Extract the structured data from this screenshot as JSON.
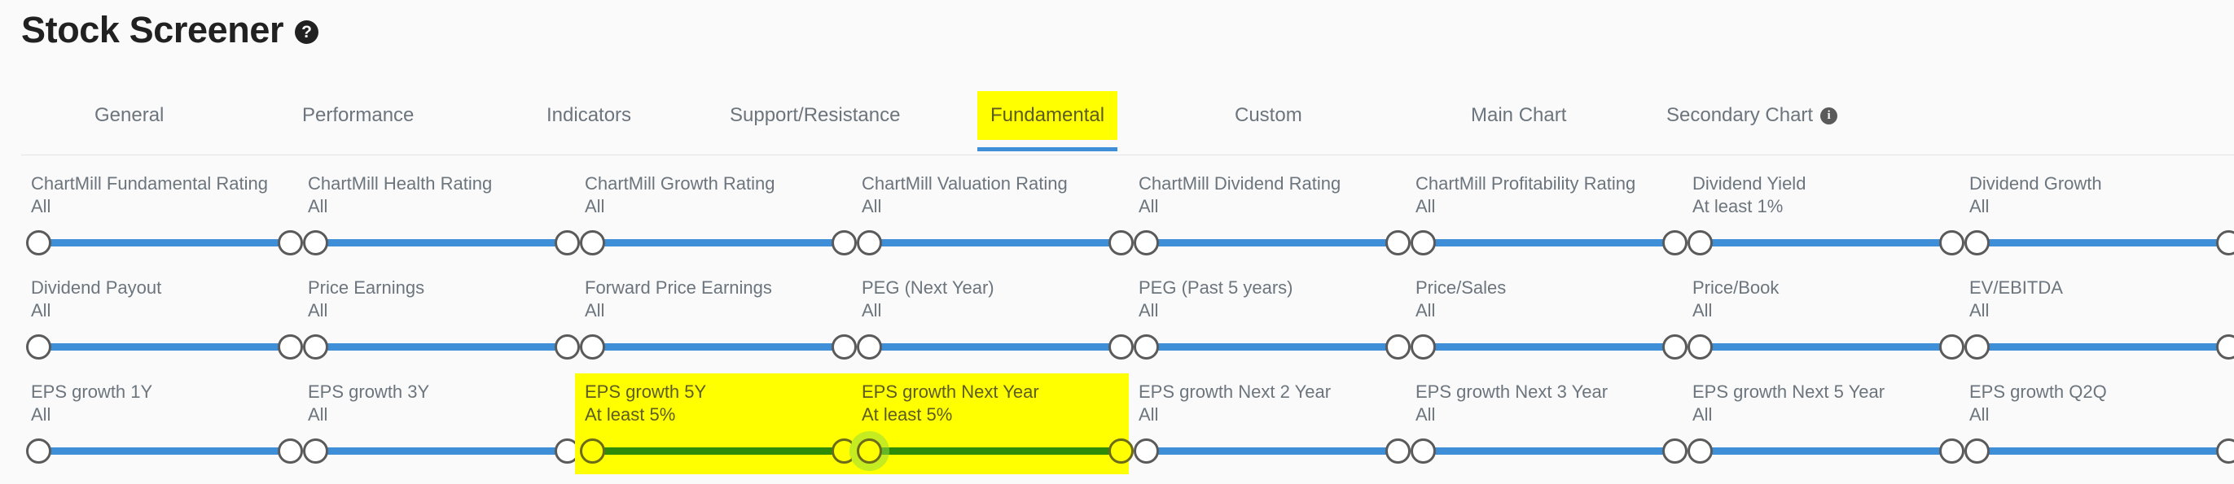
{
  "header": {
    "title": "Stock Screener",
    "help_icon_glyph": "?",
    "help_icon_name": "help-circle-icon"
  },
  "tabs": [
    {
      "label": "General",
      "active": false,
      "highlighted": false,
      "info": false
    },
    {
      "label": "Performance",
      "active": false,
      "highlighted": false,
      "info": false
    },
    {
      "label": "Indicators",
      "active": false,
      "highlighted": false,
      "info": false
    },
    {
      "label": "Support/Resistance",
      "active": false,
      "highlighted": false,
      "info": false
    },
    {
      "label": "Fundamental",
      "active": true,
      "highlighted": true,
      "info": false
    },
    {
      "label": "Custom",
      "active": false,
      "highlighted": false,
      "info": false
    },
    {
      "label": "Main Chart",
      "active": false,
      "highlighted": false,
      "info": false
    },
    {
      "label": "Secondary Chart",
      "active": false,
      "highlighted": false,
      "info": true,
      "info_glyph": "i"
    }
  ],
  "colors": {
    "page_background": "#fafafa",
    "accent_blue": "#3f8fd8",
    "highlight_yellow": "#ffff00",
    "active_green": "#2e8b07",
    "label_gray": "#6c757d",
    "title_black": "#212121"
  },
  "filters": [
    [
      {
        "label": "ChartMill Fundamental Rating",
        "value": "All",
        "highlighted": false,
        "slider": "blue"
      },
      {
        "label": "ChartMill Health Rating",
        "value": "All",
        "highlighted": false,
        "slider": "blue"
      },
      {
        "label": "ChartMill Growth Rating",
        "value": "All",
        "highlighted": false,
        "slider": "blue"
      },
      {
        "label": "ChartMill Valuation Rating",
        "value": "All",
        "highlighted": false,
        "slider": "blue"
      },
      {
        "label": "ChartMill Dividend Rating",
        "value": "All",
        "highlighted": false,
        "slider": "blue"
      },
      {
        "label": "ChartMill Profitability Rating",
        "value": "All",
        "highlighted": false,
        "slider": "blue"
      },
      {
        "label": "Dividend Yield",
        "value": "At least 1%",
        "highlighted": false,
        "slider": "blue"
      },
      {
        "label": "Dividend Growth",
        "value": "All",
        "highlighted": false,
        "slider": "blue"
      }
    ],
    [
      {
        "label": "Dividend Payout",
        "value": "All",
        "highlighted": false,
        "slider": "blue"
      },
      {
        "label": "Price Earnings",
        "value": "All",
        "highlighted": false,
        "slider": "blue"
      },
      {
        "label": "Forward Price Earnings",
        "value": "All",
        "highlighted": false,
        "slider": "blue"
      },
      {
        "label": "PEG (Next Year)",
        "value": "All",
        "highlighted": false,
        "slider": "blue"
      },
      {
        "label": "PEG (Past 5 years)",
        "value": "All",
        "highlighted": false,
        "slider": "blue"
      },
      {
        "label": "Price/Sales",
        "value": "All",
        "highlighted": false,
        "slider": "blue"
      },
      {
        "label": "Price/Book",
        "value": "All",
        "highlighted": false,
        "slider": "blue"
      },
      {
        "label": "EV/EBITDA",
        "value": "All",
        "highlighted": false,
        "slider": "blue"
      }
    ],
    [
      {
        "label": "EPS growth 1Y",
        "value": "All",
        "highlighted": false,
        "slider": "blue"
      },
      {
        "label": "EPS growth 3Y",
        "value": "All",
        "highlighted": false,
        "slider": "blue"
      },
      {
        "label": "EPS growth 5Y",
        "value": "At least 5%",
        "highlighted": true,
        "slider": "green"
      },
      {
        "label": "EPS growth Next Year",
        "value": "At least 5%",
        "highlighted": true,
        "slider": "green",
        "focus": true
      },
      {
        "label": "EPS growth Next 2 Year",
        "value": "All",
        "highlighted": false,
        "slider": "blue"
      },
      {
        "label": "EPS growth Next 3 Year",
        "value": "All",
        "highlighted": false,
        "slider": "blue"
      },
      {
        "label": "EPS growth Next 5 Year",
        "value": "All",
        "highlighted": false,
        "slider": "blue"
      },
      {
        "label": "EPS growth Q2Q",
        "value": "All",
        "highlighted": false,
        "slider": "blue"
      }
    ]
  ]
}
